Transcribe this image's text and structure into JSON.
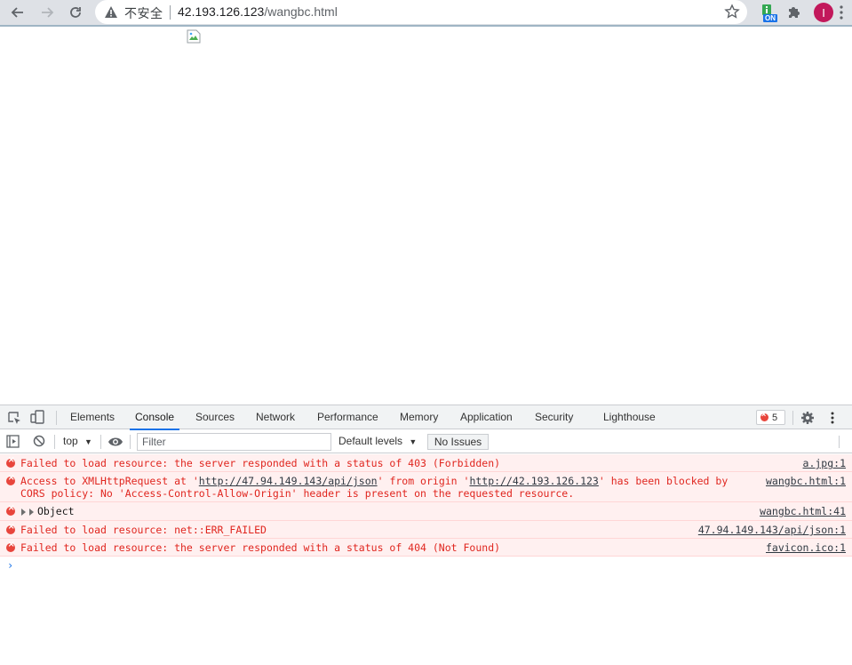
{
  "browser": {
    "security_label": "不安全",
    "url_host": "42.193.126.123",
    "url_path": "/wangbc.html",
    "extension_badge": "ON",
    "avatar_letter": "I"
  },
  "devtools": {
    "tabs": [
      {
        "label": "Elements"
      },
      {
        "label": "Console"
      },
      {
        "label": "Sources"
      },
      {
        "label": "Network"
      },
      {
        "label": "Performance"
      },
      {
        "label": "Memory"
      },
      {
        "label": "Application"
      },
      {
        "label": "Security"
      },
      {
        "label": "Lighthouse"
      }
    ],
    "active_tab": "Console",
    "error_count": "5",
    "context": "top",
    "filter_placeholder": "Filter",
    "levels_label": "Default levels",
    "issues_label": "No Issues",
    "messages": [
      {
        "text": "Failed to load resource: the server responded with a status of 403 (Forbidden)",
        "source": "a.jpg:1"
      },
      {
        "text_pre": "Access to XMLHttpRequest at '",
        "link1": "http://47.94.149.143/api/json",
        "text_mid": "' from origin '",
        "link2": "http://42.193.126.123",
        "text_post": "' has been blocked by",
        "text_line2": "CORS policy: No 'Access-Control-Allow-Origin' header is present on the requested resource.",
        "source": "wangbc.html:1"
      },
      {
        "text": "Object",
        "source": "wangbc.html:41"
      },
      {
        "text": "Failed to load resource: net::ERR_FAILED",
        "source": "47.94.149.143/api/json:1"
      },
      {
        "text": "Failed to load resource: the server responded with a status of 404 (Not Found)",
        "source": "favicon.ico:1"
      }
    ],
    "prompt_symbol": "›"
  },
  "colors": {
    "error_red": "#e0261f",
    "error_bg": "#fff0f0",
    "accent_blue": "#1a73e8"
  }
}
